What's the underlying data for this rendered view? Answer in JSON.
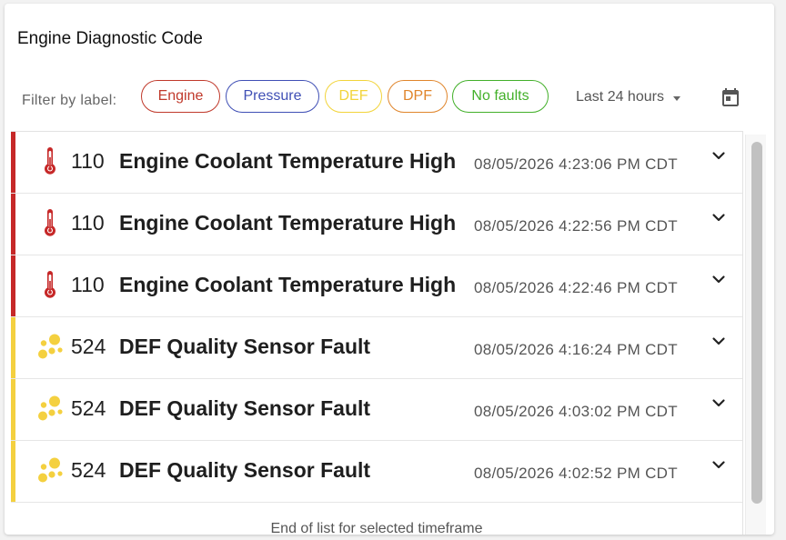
{
  "card": {
    "title": "Engine Diagnostic Code"
  },
  "filters": {
    "label": "Filter by label:",
    "chips": [
      {
        "label": "Engine",
        "color": "#c0392b"
      },
      {
        "label": "Pressure",
        "color": "#3f4fb5"
      },
      {
        "label": "DEF",
        "color": "#f2d43a"
      },
      {
        "label": "DPF",
        "color": "#e0852b"
      },
      {
        "label": "No faults",
        "color": "#43b02a"
      }
    ],
    "timeframe": "Last 24 hours",
    "calendar_icon": "calendar-icon"
  },
  "codes": [
    {
      "code": "110",
      "description": "Engine Coolant Temperature High",
      "timestamp": "08/05/2026 4:23:06 PM CDT",
      "category": "Engine",
      "icon": "thermometer-icon",
      "color": "#c62828"
    },
    {
      "code": "110",
      "description": "Engine Coolant Temperature High",
      "timestamp": "08/05/2026 4:22:56 PM CDT",
      "category": "Engine",
      "icon": "thermometer-icon",
      "color": "#c62828"
    },
    {
      "code": "110",
      "description": "Engine Coolant Temperature High",
      "timestamp": "08/05/2026 4:22:46 PM CDT",
      "category": "Engine",
      "icon": "thermometer-icon",
      "color": "#c62828"
    },
    {
      "code": "524",
      "description": "DEF Quality Sensor Fault",
      "timestamp": "08/05/2026 4:16:24 PM CDT",
      "category": "DEF",
      "icon": "bubbles-icon",
      "color": "#f4d03f"
    },
    {
      "code": "524",
      "description": "DEF Quality Sensor Fault",
      "timestamp": "08/05/2026 4:03:02 PM CDT",
      "category": "DEF",
      "icon": "bubbles-icon",
      "color": "#f4d03f"
    },
    {
      "code": "524",
      "description": "DEF Quality Sensor Fault",
      "timestamp": "08/05/2026 4:02:52 PM CDT",
      "category": "DEF",
      "icon": "bubbles-icon",
      "color": "#f4d03f"
    }
  ],
  "list_end_text": "End of list for selected timeframe"
}
